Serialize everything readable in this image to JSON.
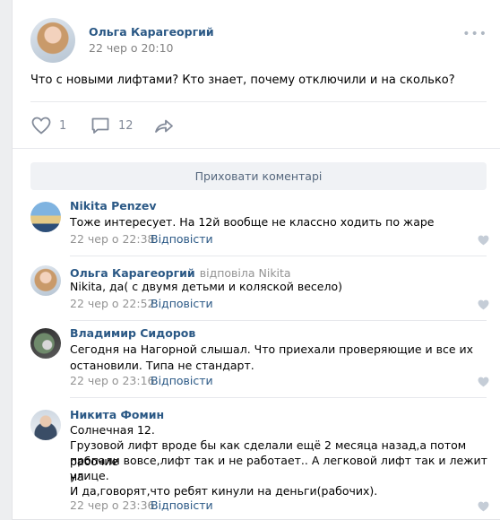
{
  "post": {
    "author": "Ольга Карагеоргий",
    "date": "22 чер о 20:10",
    "text": "Что с новыми лифтами? Кто знает, почему отключили и на сколько?",
    "likes": "1",
    "comments": "12",
    "menu_icon": "more-dots-icon"
  },
  "comments_section": {
    "hide_label": "Приховати коментарі",
    "items": [
      {
        "name": "Nikita Penzev",
        "replied": "",
        "lines": [
          "Тоже интересует. На 12й вообще не классно ходить по жаре"
        ],
        "date": "22 чер о 22:38",
        "reply": "Відповісти"
      },
      {
        "name": "Ольга Карагеоргий",
        "replied": "відповіла Nikita",
        "lines": [
          "Nikita, да( с двумя детьми и коляской весело)"
        ],
        "date": "22 чер о 22:52",
        "reply": "Відповісти"
      },
      {
        "name": "Владимир Сидоров",
        "replied": "",
        "lines": [
          "Сегодня на Нагорной слышал. Что приехали проверяющие и все их",
          "остановили. Типа не стандарт."
        ],
        "date": "22 чер о 23:16",
        "reply": "Відповісти"
      },
      {
        "name": "Никита Фомин",
        "replied": "",
        "lines": [
          "Солнечная 12.",
          "Грузовой лифт вроде бы как сделали ещё 2 месяца назад,а потом рабочие",
          "пропали вовсе,лифт так и не работает.. А легковой лифт так и лежит на",
          "улице.",
          "И да,говорят,что ребят кинули на деньги(рабочих)."
        ],
        "date": "22 чер о 23:36",
        "reply": "Відповісти"
      }
    ]
  },
  "colors": {
    "link": "#2a5885",
    "muted": "#939393",
    "icon": "#828a99"
  }
}
